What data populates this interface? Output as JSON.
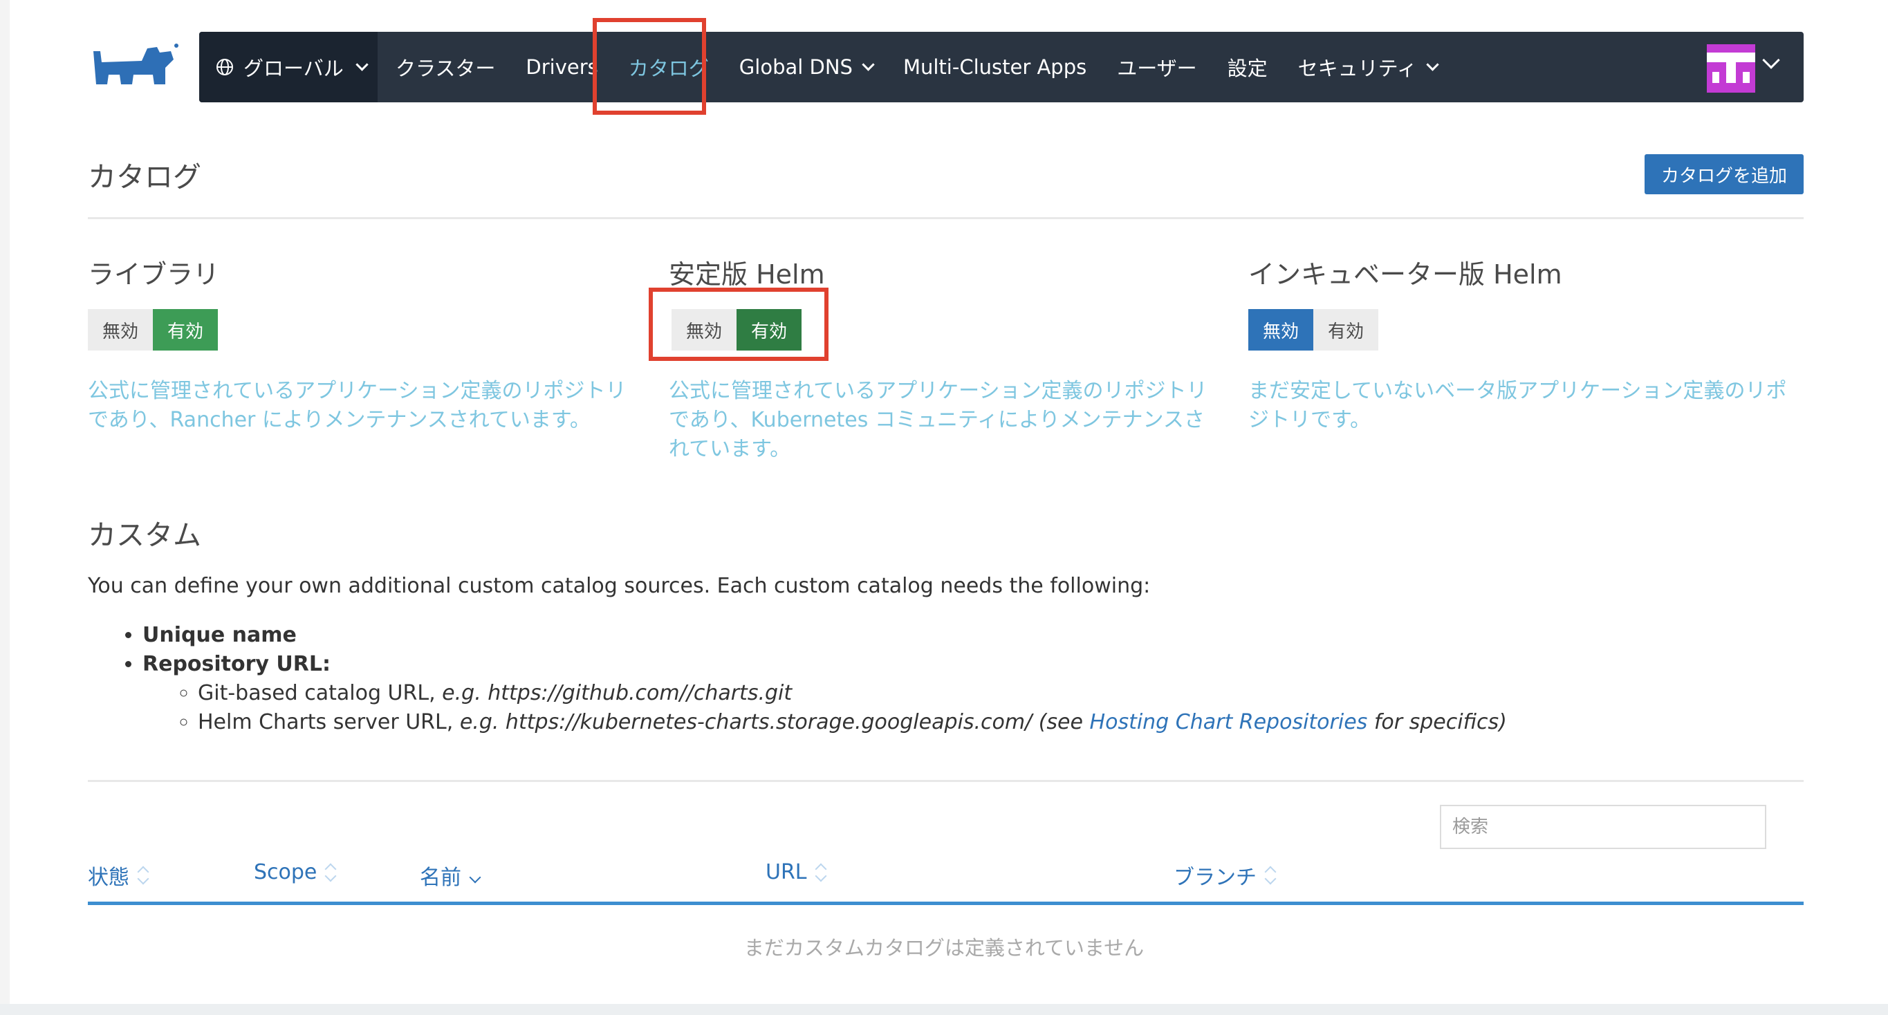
{
  "nav": {
    "global_label": "グローバル",
    "items": [
      {
        "label": "クラスター",
        "dropdown": false
      },
      {
        "label": "Drivers",
        "dropdown": false
      },
      {
        "label": "カタログ",
        "dropdown": false,
        "active": true
      },
      {
        "label": "Global DNS",
        "dropdown": true
      },
      {
        "label": "Multi-Cluster Apps",
        "dropdown": false
      },
      {
        "label": "ユーザー",
        "dropdown": false
      },
      {
        "label": "設定",
        "dropdown": false
      },
      {
        "label": "セキュリティ",
        "dropdown": true
      }
    ]
  },
  "page": {
    "title": "カタログ",
    "add_button": "カタログを追加"
  },
  "catalogs": [
    {
      "title": "ライブラリ",
      "disable_label": "無効",
      "enable_label": "有効",
      "state": "enabled",
      "description": "公式に管理されているアプリケーション定義のリポジトリであり、Rancher によりメンテナンスされています。"
    },
    {
      "title": "安定版 Helm",
      "disable_label": "無効",
      "enable_label": "有効",
      "state": "enabled",
      "description": "公式に管理されているアプリケーション定義のリポジトリであり、Kubernetes コミュニティによりメンテナンスされています。"
    },
    {
      "title": "インキュベーター版 Helm",
      "disable_label": "無効",
      "enable_label": "有効",
      "state": "disabled",
      "description": "まだ安定していないベータ版アプリケーション定義のリポジトリです。"
    }
  ],
  "custom": {
    "title": "カスタム",
    "intro": "You can define your own additional custom catalog sources. Each custom catalog needs the following:",
    "req_name": "Unique name",
    "req_url": "Repository URL:",
    "git_prefix": "Git-based catalog URL,",
    "git_eg": "e.g. https://github.com//charts.git",
    "helm_prefix": "Helm Charts server URL,",
    "helm_eg": "e.g. https://kubernetes-charts.storage.googleapis.com/ (see",
    "helm_link": "Hosting Chart Repositories",
    "helm_suffix": "for specifics)"
  },
  "table": {
    "search_placeholder": "検索",
    "columns": [
      "状態",
      "Scope",
      "名前",
      "URL",
      "ブランチ"
    ],
    "empty_message": "まだカスタムカタログは定義されていません"
  },
  "colors": {
    "nav_bg": "#2a3441",
    "accent_blue": "#2e73b8",
    "link_teal": "#7ec6e0",
    "enabled_green": "#3d9c56",
    "highlight_red": "#e0412f",
    "avatar": "#c33bd4"
  }
}
